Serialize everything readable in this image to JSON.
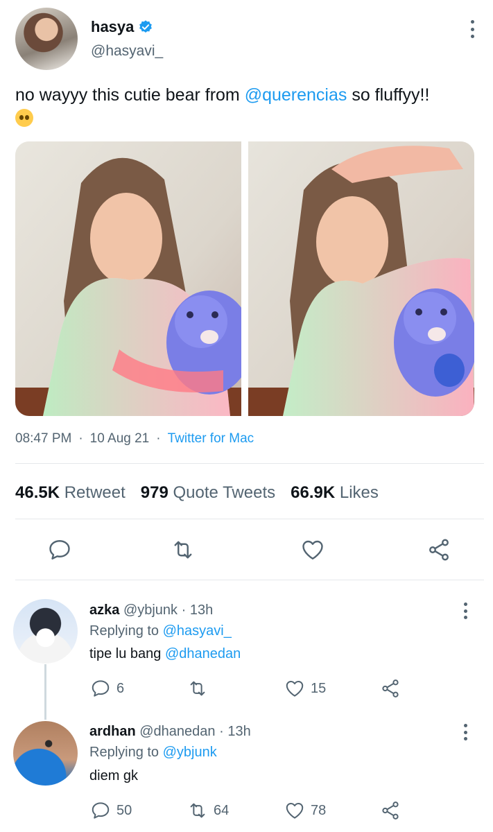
{
  "tweet": {
    "author": {
      "display_name": "hasya",
      "handle": "@hasyavi_",
      "verified": true
    },
    "text_before": "no wayyy this cutie bear from ",
    "mention": "@querencias",
    "text_after": " so fluffyy!!",
    "emoji": "pleading-face-emoji",
    "time": "08:47 PM",
    "date": "10 Aug 21",
    "source": "Twitter for Mac",
    "sep": "·",
    "stats": {
      "retweets_count": "46.5K",
      "retweets_label": "Retweet",
      "quotes_count": "979",
      "quotes_label": "Quote Tweets",
      "likes_count": "66.9K",
      "likes_label": "Likes"
    }
  },
  "replies": [
    {
      "name": "azka",
      "handle": "@ybjunk",
      "time": "· 13h",
      "replying_prefix": "Replying to ",
      "replying_to": "@hasyavi_",
      "text_before": "tipe lu bang ",
      "text_mention": "@dhanedan",
      "replies": "6",
      "retweets": "",
      "likes": "15"
    },
    {
      "name": "ardhan",
      "handle": "@dhanedan",
      "time": "· 13h",
      "replying_prefix": "Replying to ",
      "replying_to": "@ybjunk",
      "text_before": "diem gk",
      "text_mention": "",
      "replies": "50",
      "retweets": "64",
      "likes": "78"
    }
  ],
  "colors": {
    "accent": "#1d9bf0",
    "secondary_text": "#536471",
    "divider": "#e5e8eb"
  },
  "icons": [
    "verified-badge-icon",
    "more-icon",
    "reply-icon",
    "retweet-icon",
    "like-icon",
    "share-icon"
  ]
}
